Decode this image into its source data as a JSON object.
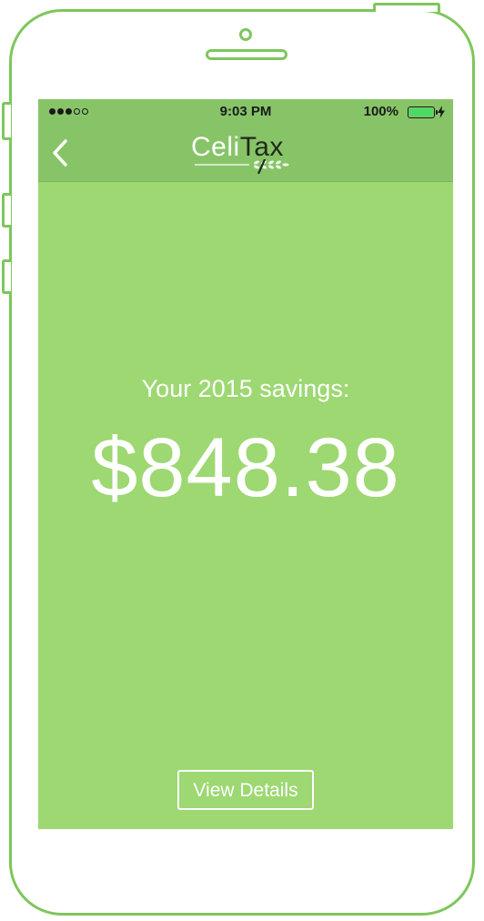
{
  "status_bar": {
    "signal_dots_filled": 3,
    "signal_dots_total": 5,
    "time": "9:03 PM",
    "battery_percent": "100%",
    "battery_level": 1.0,
    "battery_color": "#4cd964"
  },
  "nav": {
    "back_icon": "chevron-left-icon",
    "logo": {
      "part1": "Celi",
      "part2": "Tax"
    }
  },
  "main": {
    "savings_label": "Your 2015 savings:",
    "savings_amount": "$848.38",
    "details_button": "View Details"
  },
  "colors": {
    "frame": "#7ec65c",
    "screen_bg": "#9dd872",
    "bar_bg": "#87c468",
    "text": "#ffffff"
  }
}
